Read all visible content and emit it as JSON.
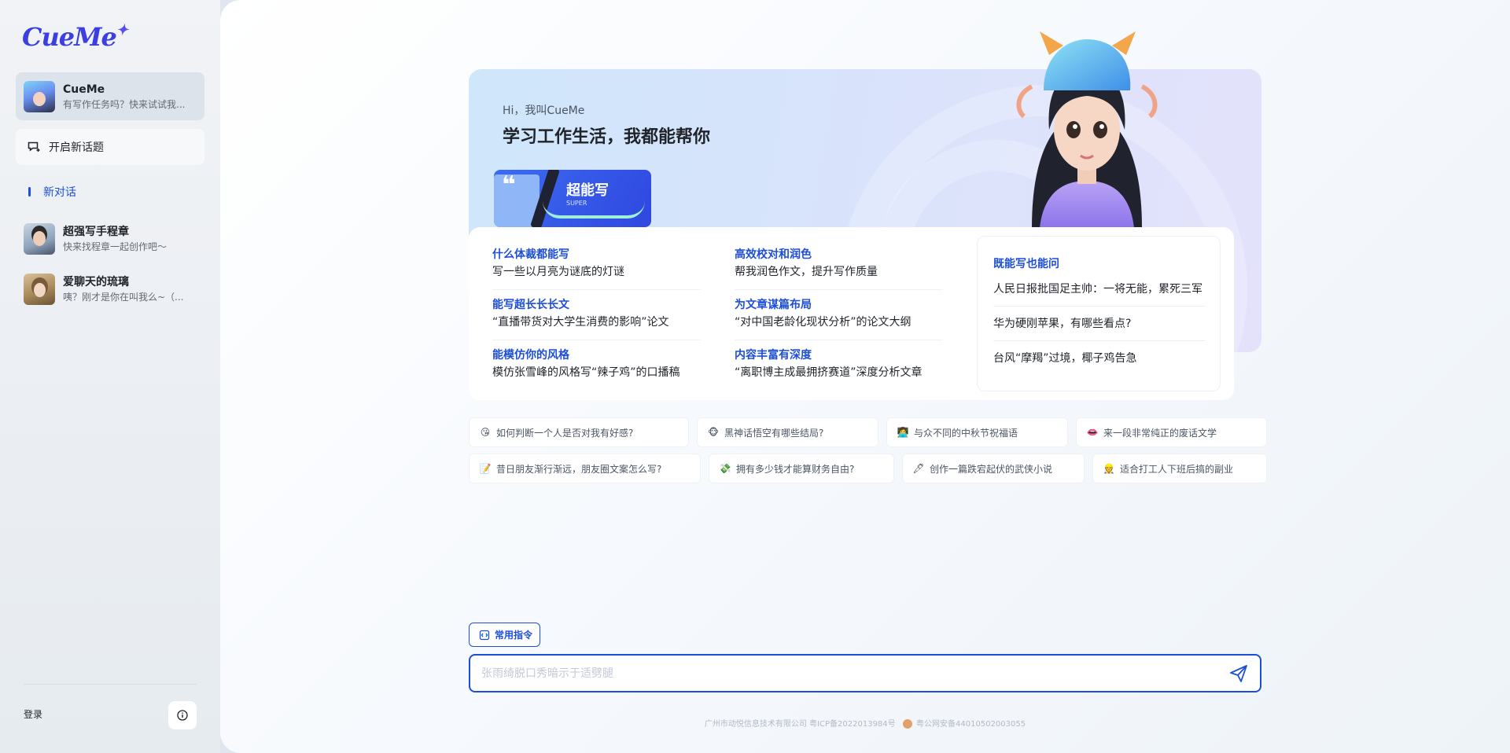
{
  "sidebar": {
    "logo": "CueMe",
    "logo_spark": "✦",
    "bot": {
      "name": "CueMe",
      "subtitle": "有写作任务吗？快来试试我..."
    },
    "new_topic_label": "开启新话题",
    "nav_new_chat": "新对话",
    "conversations": [
      {
        "name": "超强写手程章",
        "subtitle": "快来找程章一起创作吧～"
      },
      {
        "name": "爱聊天的琉璃",
        "subtitle": "咦？刚才是你在叫我么~（..."
      }
    ],
    "login_label": "登录"
  },
  "hero": {
    "greeting": "Hi，我叫CueMe",
    "headline": "学习工作生活，我都能帮你",
    "badge_title": "超能写",
    "badge_sub": "SUPER",
    "badge_quote": "❝"
  },
  "features": [
    {
      "title": "什么体裁都能写",
      "desc": "写一些以月亮为谜底的灯谜"
    },
    {
      "title": "能写超长长长文",
      "desc": "“直播带货对大学生消费的影响”论文"
    },
    {
      "title": "能模仿你的风格",
      "desc": "模仿张雪峰的风格写“辣子鸡”的口播稿"
    },
    {
      "title": "高效校对和润色",
      "desc": "帮我润色作文，提升写作质量"
    },
    {
      "title": "为文章谋篇布局",
      "desc": "“对中国老龄化现状分析”的论文大纲"
    },
    {
      "title": "内容丰富有深度",
      "desc": "“离职博主成最拥挤赛道”深度分析文章"
    }
  ],
  "ask": {
    "title": "既能写也能问",
    "items": [
      "人民日报批国足主帅：一将无能，累死三军",
      "华为硬刚苹果，有哪些看点?",
      "台风“摩羯”过境，椰子鸡告急"
    ]
  },
  "chips": [
    {
      "emoji": "😘",
      "label": "如何判断一个人是否对我有好感?"
    },
    {
      "emoji": "🐵",
      "label": "黑神话悟空有哪些结局?"
    },
    {
      "emoji": "👩‍💻",
      "label": "与众不同的中秋节祝福语"
    },
    {
      "emoji": "👄",
      "label": "来一段非常纯正的废话文学"
    },
    {
      "emoji": "📝",
      "label": "昔日朋友渐行渐远，朋友圈文案怎么写?"
    },
    {
      "emoji": "💸",
      "label": "拥有多少钱才能算财务自由?"
    },
    {
      "emoji": "🖋",
      "label": "创作一篇跌宕起伏的武侠小说"
    },
    {
      "emoji": "👷",
      "label": "适合打工人下班后搞的副业"
    }
  ],
  "composer": {
    "command_label": "常用指令",
    "placeholder": "张雨绮脱口秀暗示于适劈腿"
  },
  "footer": {
    "company": "广州市动悦信息技术有限公司 粤ICP备2022013984号",
    "police": "粤公网安备44010502003055"
  },
  "colors": {
    "accent": "#1d4ed8",
    "sidebar_bg": "#eef1f4"
  }
}
